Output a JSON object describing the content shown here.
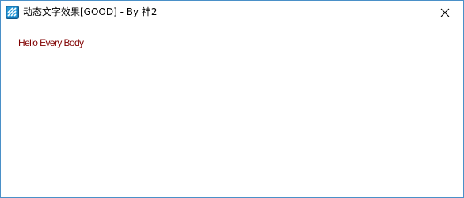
{
  "window": {
    "title": "动态文字效果[GOOD] - By 神2",
    "close_icon": "close-icon",
    "app_icon": "app-icon"
  },
  "content": {
    "animated_text": "Hello Every Body",
    "text_color": "#800000"
  }
}
